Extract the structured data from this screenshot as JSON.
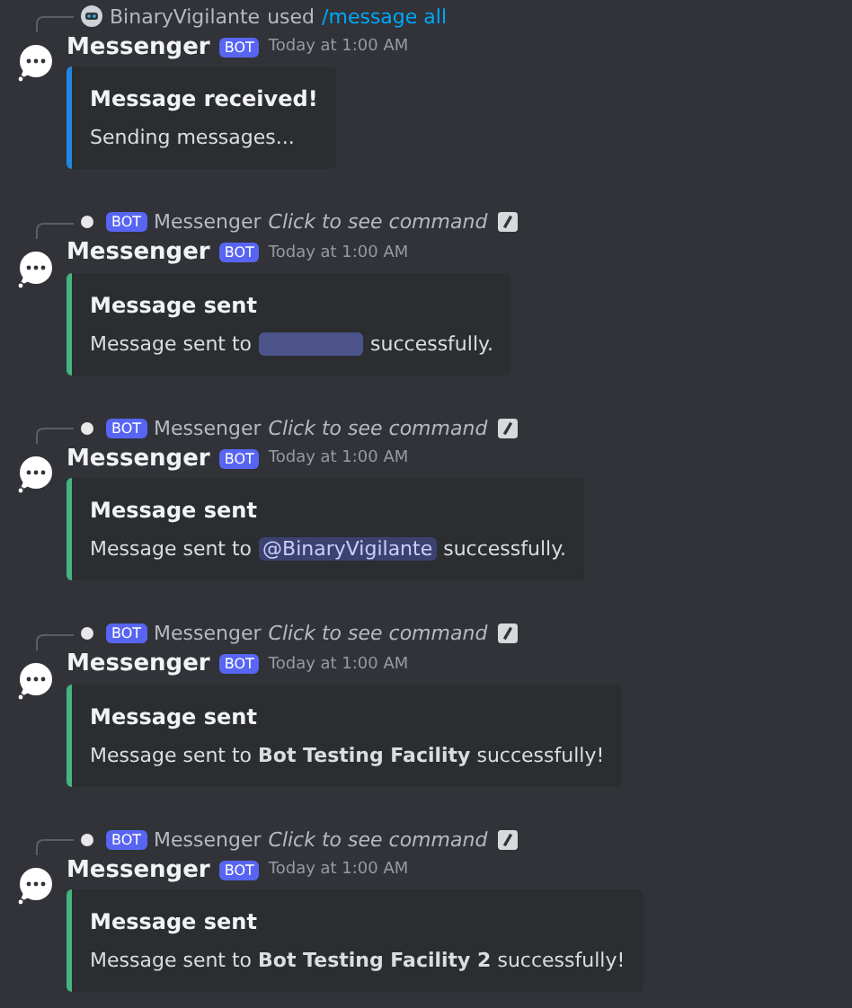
{
  "messages": [
    {
      "reply": {
        "kind": "user",
        "user": "BinaryVigilante",
        "verb": "used",
        "command": "/message all"
      },
      "author": "Messenger",
      "badge": "BOT",
      "time": "Today at 1:00 AM",
      "embed": {
        "color": "#1e88e5",
        "title": "Message received!",
        "description": [
          {
            "kind": "text",
            "text": "Sending messages..."
          }
        ]
      }
    },
    {
      "reply": {
        "kind": "bot",
        "badge": "BOT",
        "name": "Messenger",
        "hint": "Click to see command"
      },
      "author": "Messenger",
      "badge": "BOT",
      "time": "Today at 1:00 AM",
      "embed": {
        "color": "#43b581",
        "title": "Message sent",
        "description": [
          {
            "kind": "text",
            "text": "Message sent to"
          },
          {
            "kind": "redacted"
          },
          {
            "kind": "text",
            "text": "successfully."
          }
        ]
      }
    },
    {
      "reply": {
        "kind": "bot",
        "badge": "BOT",
        "name": "Messenger",
        "hint": "Click to see command"
      },
      "author": "Messenger",
      "badge": "BOT",
      "time": "Today at 1:00 AM",
      "embed": {
        "color": "#43b581",
        "title": "Message sent",
        "description": [
          {
            "kind": "text",
            "text": "Message sent to"
          },
          {
            "kind": "mention",
            "text": "@BinaryVigilante"
          },
          {
            "kind": "text",
            "text": "successfully."
          }
        ]
      }
    },
    {
      "reply": {
        "kind": "bot",
        "badge": "BOT",
        "name": "Messenger",
        "hint": "Click to see command"
      },
      "author": "Messenger",
      "badge": "BOT",
      "time": "Today at 1:00 AM",
      "embed": {
        "color": "#43b581",
        "title": "Message sent",
        "description": [
          {
            "kind": "text",
            "text": "Message sent to **Bot Testing Facility** successfully!"
          }
        ]
      }
    },
    {
      "reply": {
        "kind": "bot",
        "badge": "BOT",
        "name": "Messenger",
        "hint": "Click to see command"
      },
      "author": "Messenger",
      "badge": "BOT",
      "time": "Today at 1:00 AM",
      "embed": {
        "color": "#43b581",
        "title": "Message sent",
        "description": [
          {
            "kind": "text",
            "text": "Message sent to **Bot Testing Facility 2** successfully!"
          }
        ]
      }
    }
  ]
}
